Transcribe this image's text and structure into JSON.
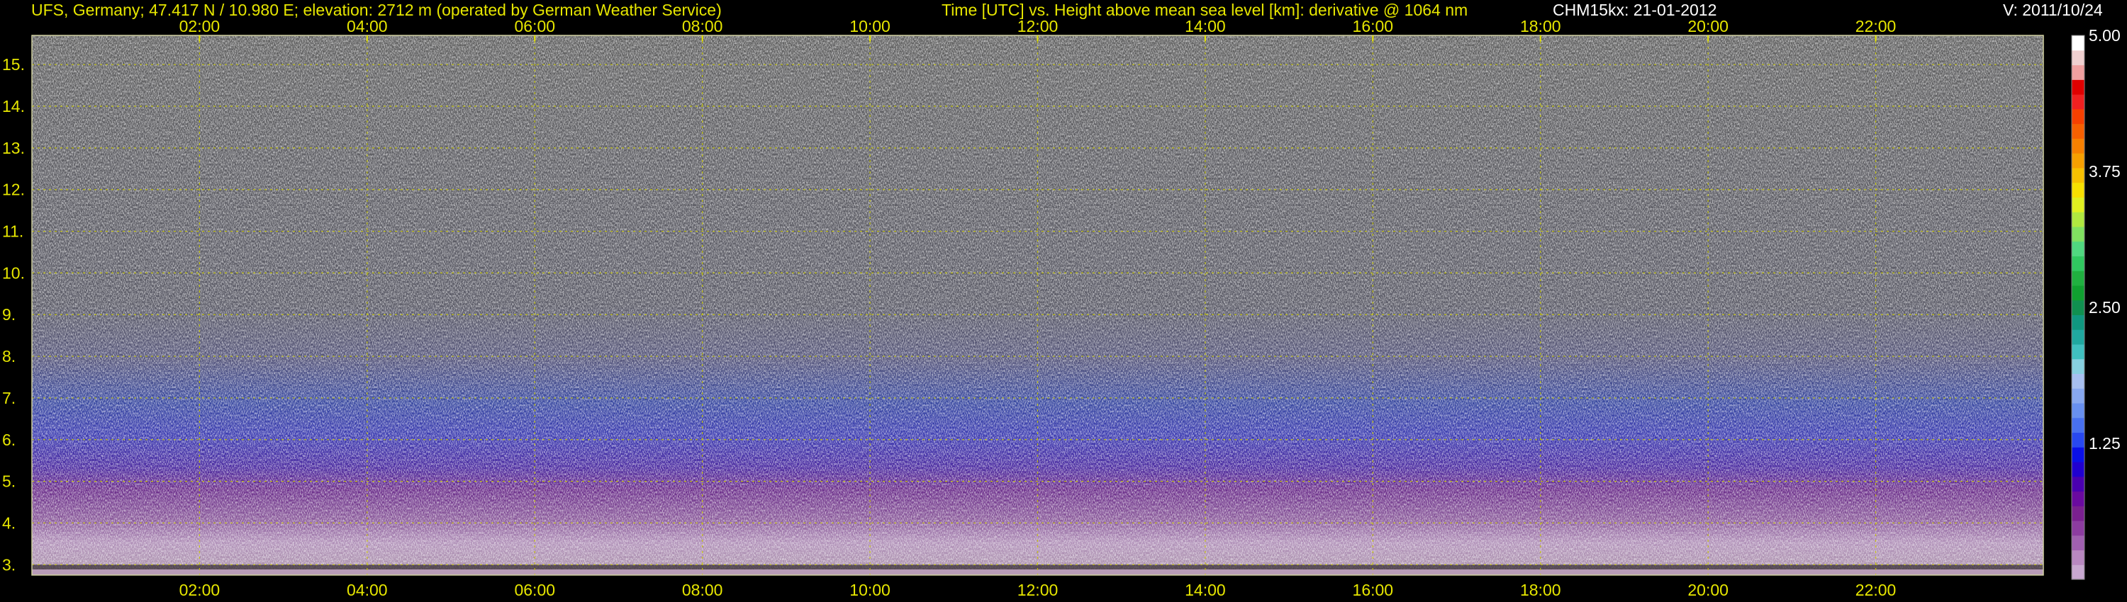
{
  "header": {
    "station": "UFS, Germany; 47.417 N / 10.980 E; elevation: 2712 m  (operated by German Weather Service)",
    "axes_desc": "Time [UTC] vs. Height above mean sea level [km]: derivative @ 1064 nm",
    "instrument": "CHM15kx: 21-01-2012",
    "version": "V: 2011/10/24"
  },
  "colors": {
    "text_yellow": "#e6e600",
    "grid": "#c8c800",
    "background": "#000000"
  },
  "chart_data": {
    "type": "heatmap",
    "title": "Time [UTC] vs. Height above mean sea level [km]: derivative @ 1064 nm",
    "xlabel": "Time [UTC]",
    "ylabel": "Height above mean sea level [km]",
    "x_range_hours": [
      0,
      24
    ],
    "x_ticks": [
      "02:00",
      "04:00",
      "06:00",
      "08:00",
      "10:00",
      "12:00",
      "14:00",
      "16:00",
      "18:00",
      "20:00",
      "22:00"
    ],
    "x_tick_hours": [
      2,
      4,
      6,
      8,
      10,
      12,
      14,
      16,
      18,
      20,
      22
    ],
    "y_range_km": [
      2.75,
      15.7
    ],
    "y_ticks": [
      "3.",
      "4.",
      "5.",
      "6.",
      "7.",
      "8.",
      "9.",
      "10.",
      "11.",
      "12.",
      "13.",
      "14.",
      "15."
    ],
    "y_tick_values": [
      3,
      4,
      5,
      6,
      7,
      8,
      9,
      10,
      11,
      12,
      13,
      14,
      15
    ],
    "colorbar": {
      "range": [
        0,
        5
      ],
      "tick_labels": [
        "1.25",
        "2.50",
        "3.75",
        "5.00"
      ],
      "tick_values": [
        1.25,
        2.5,
        3.75,
        5.0
      ],
      "colors": [
        "#c8a8d0",
        "#b888c0",
        "#a060b0",
        "#8c3ca0",
        "#7a2090",
        "#6a0aa0",
        "#4a00b0",
        "#2000d0",
        "#0a10e8",
        "#2848f0",
        "#4870f0",
        "#6890f0",
        "#88a8f0",
        "#a8c0f0",
        "#88d0e0",
        "#40c0c0",
        "#20a8a0",
        "#109880",
        "#109050",
        "#10a030",
        "#20b040",
        "#30c860",
        "#50d880",
        "#80e060",
        "#b0e840",
        "#e0f020",
        "#f8e000",
        "#f8c000",
        "#f8a000",
        "#f88000",
        "#f86000",
        "#f84000",
        "#f02020",
        "#e00000",
        "#f0a0a0",
        "#f0d0d0",
        "#ffffff"
      ]
    },
    "grid": true,
    "description_bands": [
      {
        "from_km": 2.75,
        "to_km": 4.0,
        "tone": "mauve-pink noise"
      },
      {
        "from_km": 4.0,
        "to_km": 5.5,
        "tone": "purple noise"
      },
      {
        "from_km": 5.5,
        "to_km": 7.5,
        "tone": "blue noise"
      },
      {
        "from_km": 7.5,
        "to_km": 15.7,
        "tone": "grey-white noise"
      }
    ]
  }
}
